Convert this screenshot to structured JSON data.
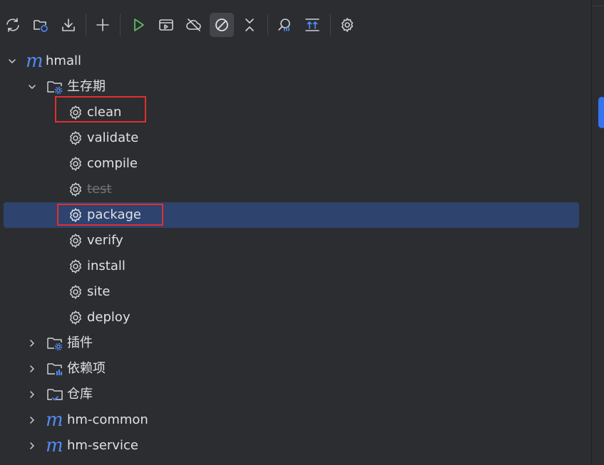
{
  "toolbar": {
    "buttons": [
      {
        "name": "reload-all-projects-icon"
      },
      {
        "name": "generate-sources-icon"
      },
      {
        "name": "download-sources-icon"
      },
      {
        "name": "add-project-icon"
      },
      {
        "name": "run-icon"
      },
      {
        "name": "execute-goal-icon"
      },
      {
        "name": "offline-mode-icon"
      },
      {
        "name": "skip-tests-icon",
        "active": true
      },
      {
        "name": "collapse-all-icon"
      },
      {
        "name": "analyze-dependencies-icon"
      },
      {
        "name": "show-dependencies-icon"
      },
      {
        "name": "settings-icon"
      }
    ]
  },
  "tree": {
    "root": {
      "label": "hmall",
      "expanded": true
    },
    "lifecycle": {
      "label": "生存期",
      "expanded": true
    },
    "goals": [
      {
        "label": "clean",
        "highlighted": true
      },
      {
        "label": "validate"
      },
      {
        "label": "compile"
      },
      {
        "label": "test",
        "disabled": true
      },
      {
        "label": "package",
        "selected": true,
        "highlighted": true
      },
      {
        "label": "verify"
      },
      {
        "label": "install"
      },
      {
        "label": "site"
      },
      {
        "label": "deploy"
      }
    ],
    "folders": [
      {
        "label": "插件",
        "icon": "plugins-folder-icon"
      },
      {
        "label": "依赖项",
        "icon": "dependencies-folder-icon"
      },
      {
        "label": "仓库",
        "icon": "repositories-folder-icon"
      }
    ],
    "modules": [
      {
        "label": "hm-common"
      },
      {
        "label": "hm-service"
      }
    ],
    "colors": {
      "background": "#2b2d30",
      "selection": "#2e436e",
      "highlight_box": "#e0302f",
      "maven_accent": "#548af7",
      "run_green": "#5fb865"
    }
  }
}
